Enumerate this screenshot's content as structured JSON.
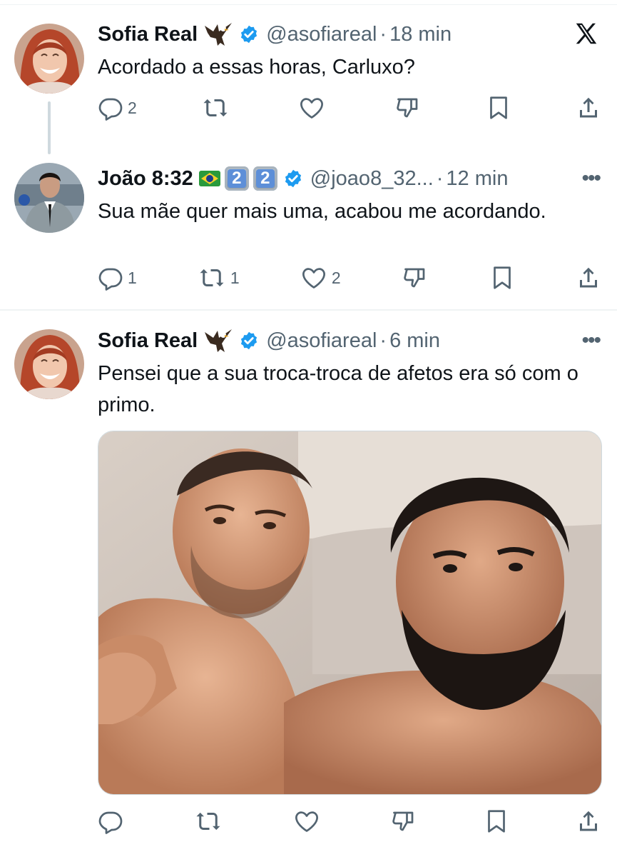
{
  "thread": {
    "tweets": [
      {
        "name": "Sofia Real",
        "handle": "@asofiareal",
        "time": "18 min",
        "text": "Acordado a essas horas, Carluxo?",
        "replies": "2",
        "retweets": "",
        "likes": "",
        "avatar_icon": "woman-laughing-avatar"
      },
      {
        "name": "João 8:32",
        "badges": [
          "2",
          "2"
        ],
        "handle": "@joao8_32...",
        "time": "12 min",
        "text": "Sua mãe quer mais uma, acabou me acordando.",
        "replies": "1",
        "retweets": "1",
        "likes": "2",
        "avatar_icon": "man-in-suit-avatar"
      },
      {
        "name": "Sofia Real",
        "handle": "@asofiareal",
        "time": "6 min",
        "text": "Pensei que a sua troca-troca de afetos era só com o primo.",
        "replies": "",
        "retweets": "",
        "likes": "",
        "avatar_icon": "woman-laughing-avatar",
        "media": "selfie-photo-two-men"
      }
    ]
  },
  "separator": "·",
  "colors": {
    "verified": "#1d9bf0",
    "text_primary": "#0f1419",
    "text_secondary": "#536471",
    "divider": "#eff3f4"
  }
}
